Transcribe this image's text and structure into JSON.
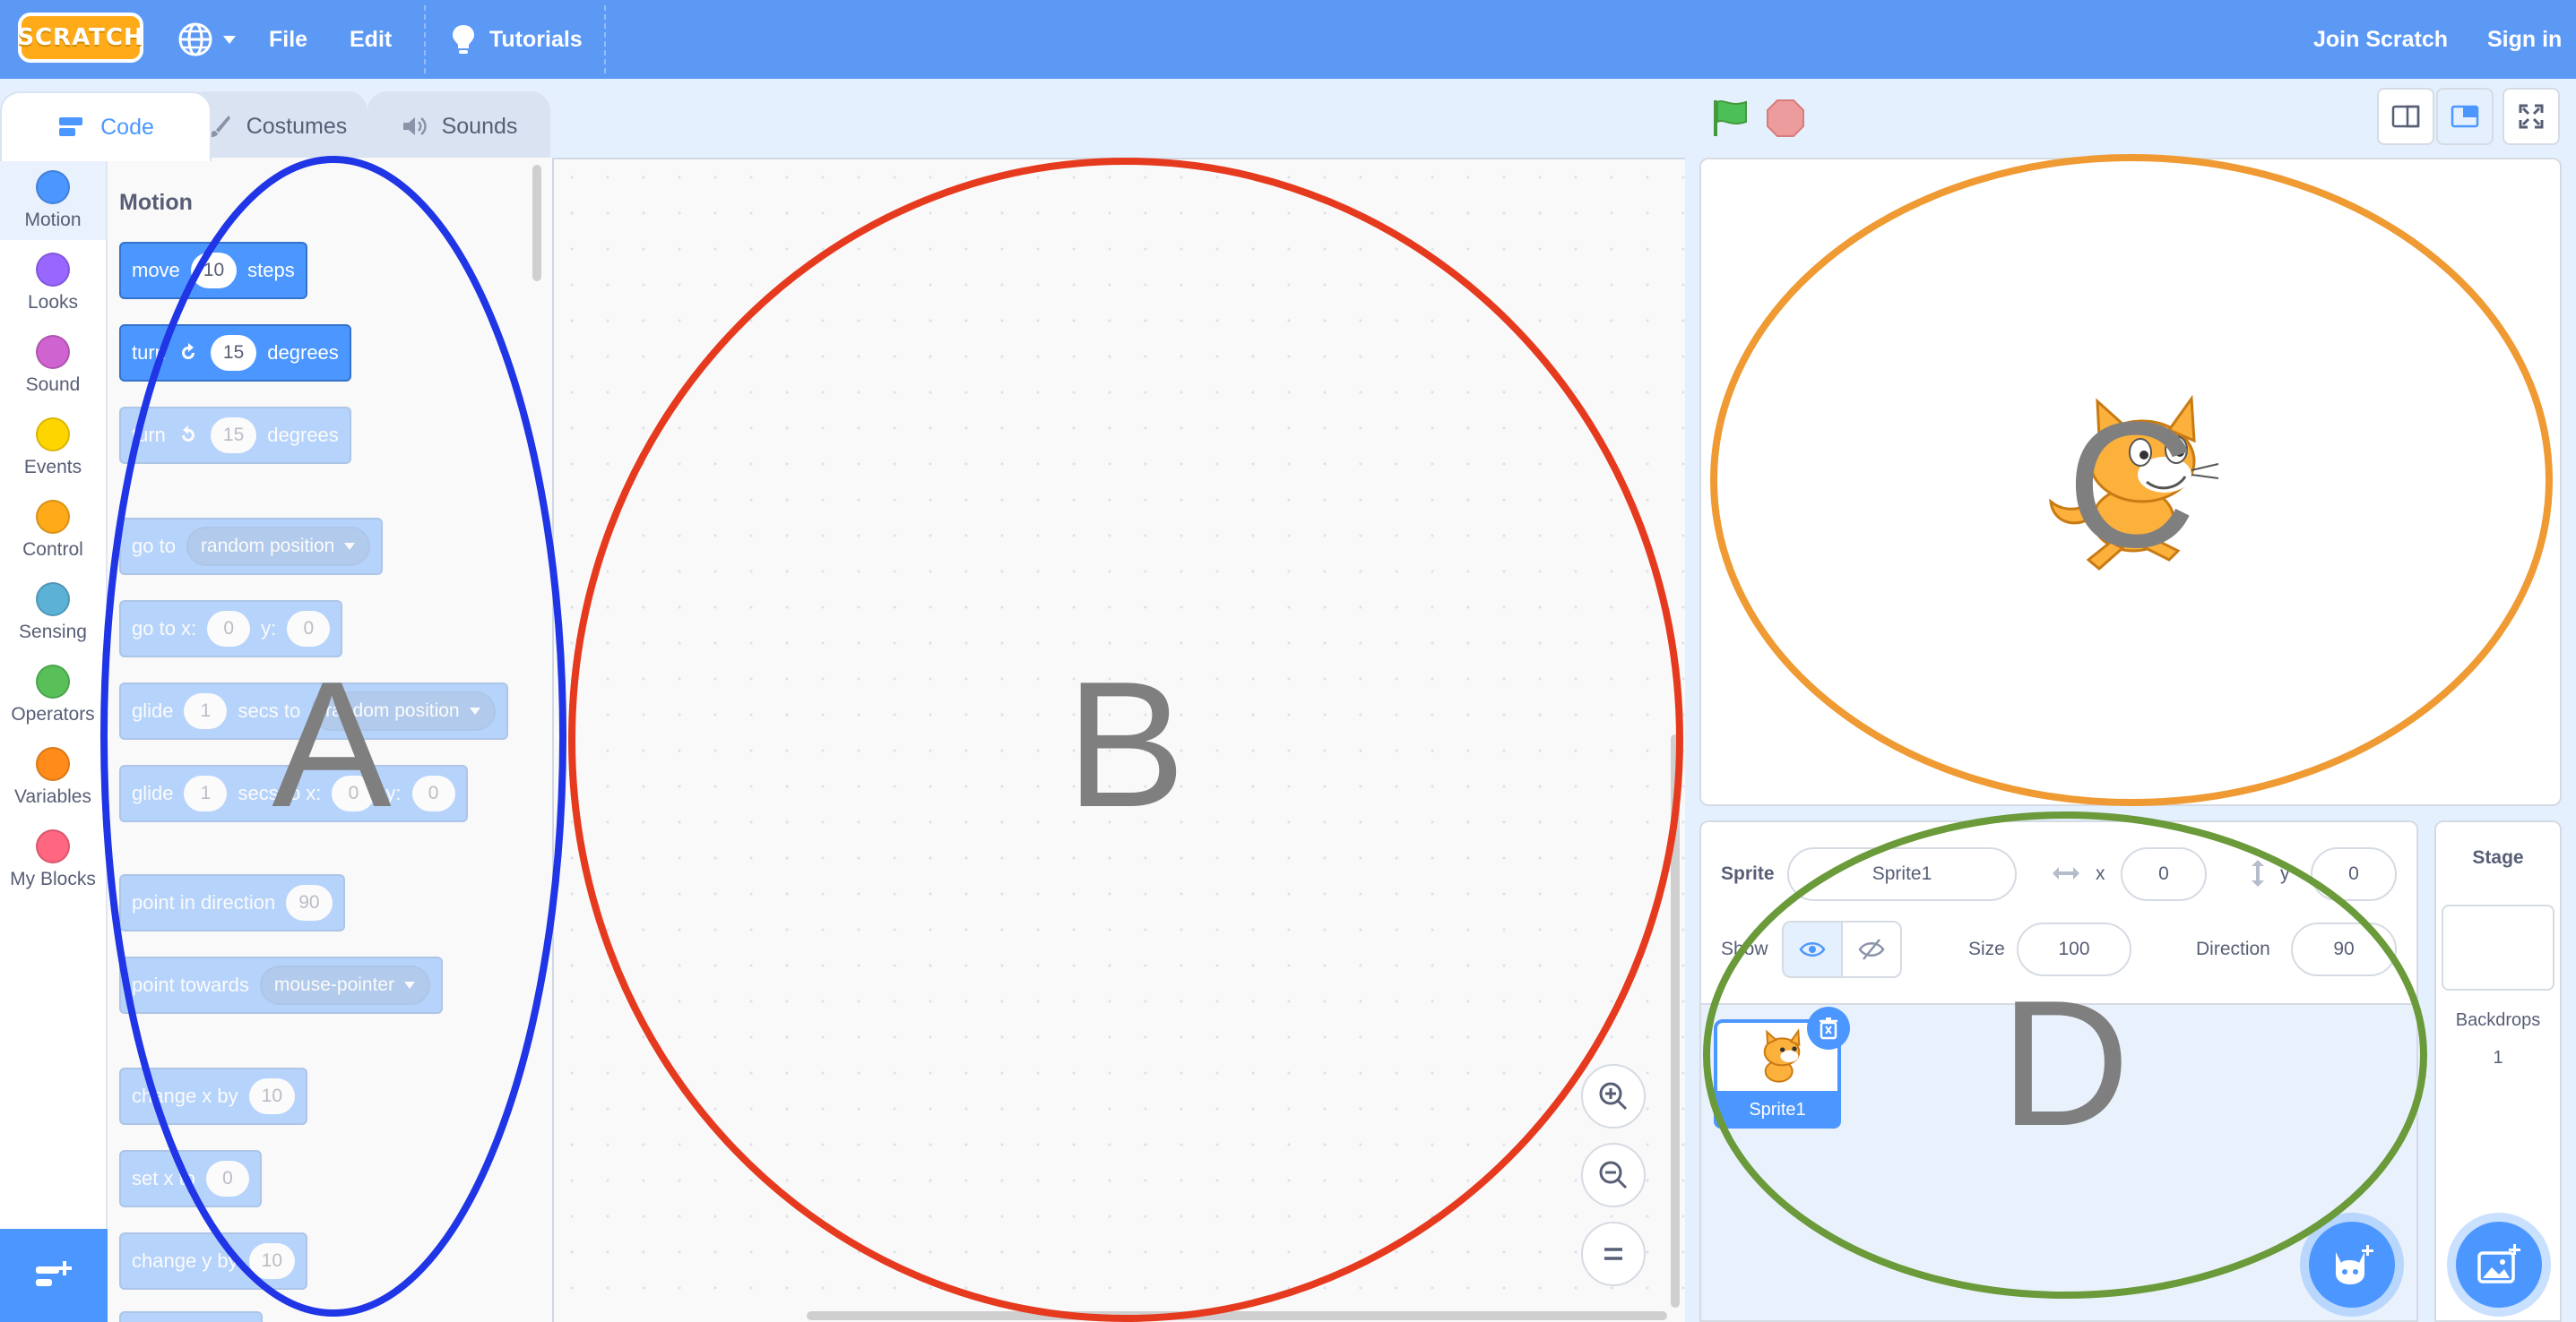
{
  "menubar": {
    "logo_text": "SCRATCH",
    "file": "File",
    "edit": "Edit",
    "tutorials": "Tutorials",
    "join": "Join Scratch",
    "signin": "Sign in",
    "icons": [
      "globe-icon",
      "lightbulb-icon"
    ]
  },
  "tabs": {
    "code": "Code",
    "costumes": "Costumes",
    "sounds": "Sounds"
  },
  "categories": [
    {
      "label": "Motion",
      "color": "#4c97ff"
    },
    {
      "label": "Looks",
      "color": "#9966ff"
    },
    {
      "label": "Sound",
      "color": "#cf63cf"
    },
    {
      "label": "Events",
      "color": "#ffd500"
    },
    {
      "label": "Control",
      "color": "#ffab19"
    },
    {
      "label": "Sensing",
      "color": "#5cb1d6"
    },
    {
      "label": "Operators",
      "color": "#59c059"
    },
    {
      "label": "Variables",
      "color": "#ff8c1a"
    },
    {
      "label": "My Blocks",
      "color": "#ff6680"
    }
  ],
  "palette": {
    "heading": "Motion",
    "blocks": {
      "move": {
        "w1": "move",
        "v1": "10",
        "w2": "steps"
      },
      "turn_right": {
        "w1": "turn",
        "v1": "15",
        "w2": "degrees"
      },
      "turn_left": {
        "w1": "turn",
        "v1": "15",
        "w2": "degrees"
      },
      "go_to": {
        "w1": "go to",
        "menu": "random position"
      },
      "go_to_xy": {
        "w1": "go to x:",
        "v1": "0",
        "w2": "y:",
        "v2": "0"
      },
      "glide_to": {
        "w1": "glide",
        "v1": "1",
        "w2": "secs to",
        "menu": "random position"
      },
      "glide_xy": {
        "w1": "glide",
        "v1": "1",
        "w2": "secs to x:",
        "v2": "0",
        "w3": "y:",
        "v3": "0"
      },
      "point_dir": {
        "w1": "point in direction",
        "v1": "90"
      },
      "point_towards": {
        "w1": "point towards",
        "menu": "mouse-pointer"
      },
      "change_x": {
        "w1": "change x by",
        "v1": "10"
      },
      "set_x": {
        "w1": "set x to",
        "v1": "0"
      },
      "change_y": {
        "w1": "change y by",
        "v1": "10"
      }
    }
  },
  "sprite_info": {
    "sprite_label": "Sprite",
    "sprite_name": "Sprite1",
    "x_label": "x",
    "x_value": "0",
    "y_label": "y",
    "y_value": "0",
    "show_label": "Show",
    "size_label": "Size",
    "size_value": "100",
    "direction_label": "Direction",
    "direction_value": "90"
  },
  "sprite_list": {
    "sprite_name": "Sprite1"
  },
  "stage_pane": {
    "title": "Stage",
    "backdrops_label": "Backdrops",
    "backdrops_count": "1"
  },
  "annotations": {
    "a": {
      "letter": "A",
      "color": "#1f35e6"
    },
    "b": {
      "letter": "B",
      "color": "#e63a1f"
    },
    "c": {
      "letter": "C",
      "color": "#ef9a33"
    },
    "d": {
      "letter": "D",
      "color": "#6a9a3a"
    }
  },
  "colors": {
    "menubar": "#5c99f5",
    "motion": "#4c97ff",
    "background": "#e5f0ff"
  }
}
